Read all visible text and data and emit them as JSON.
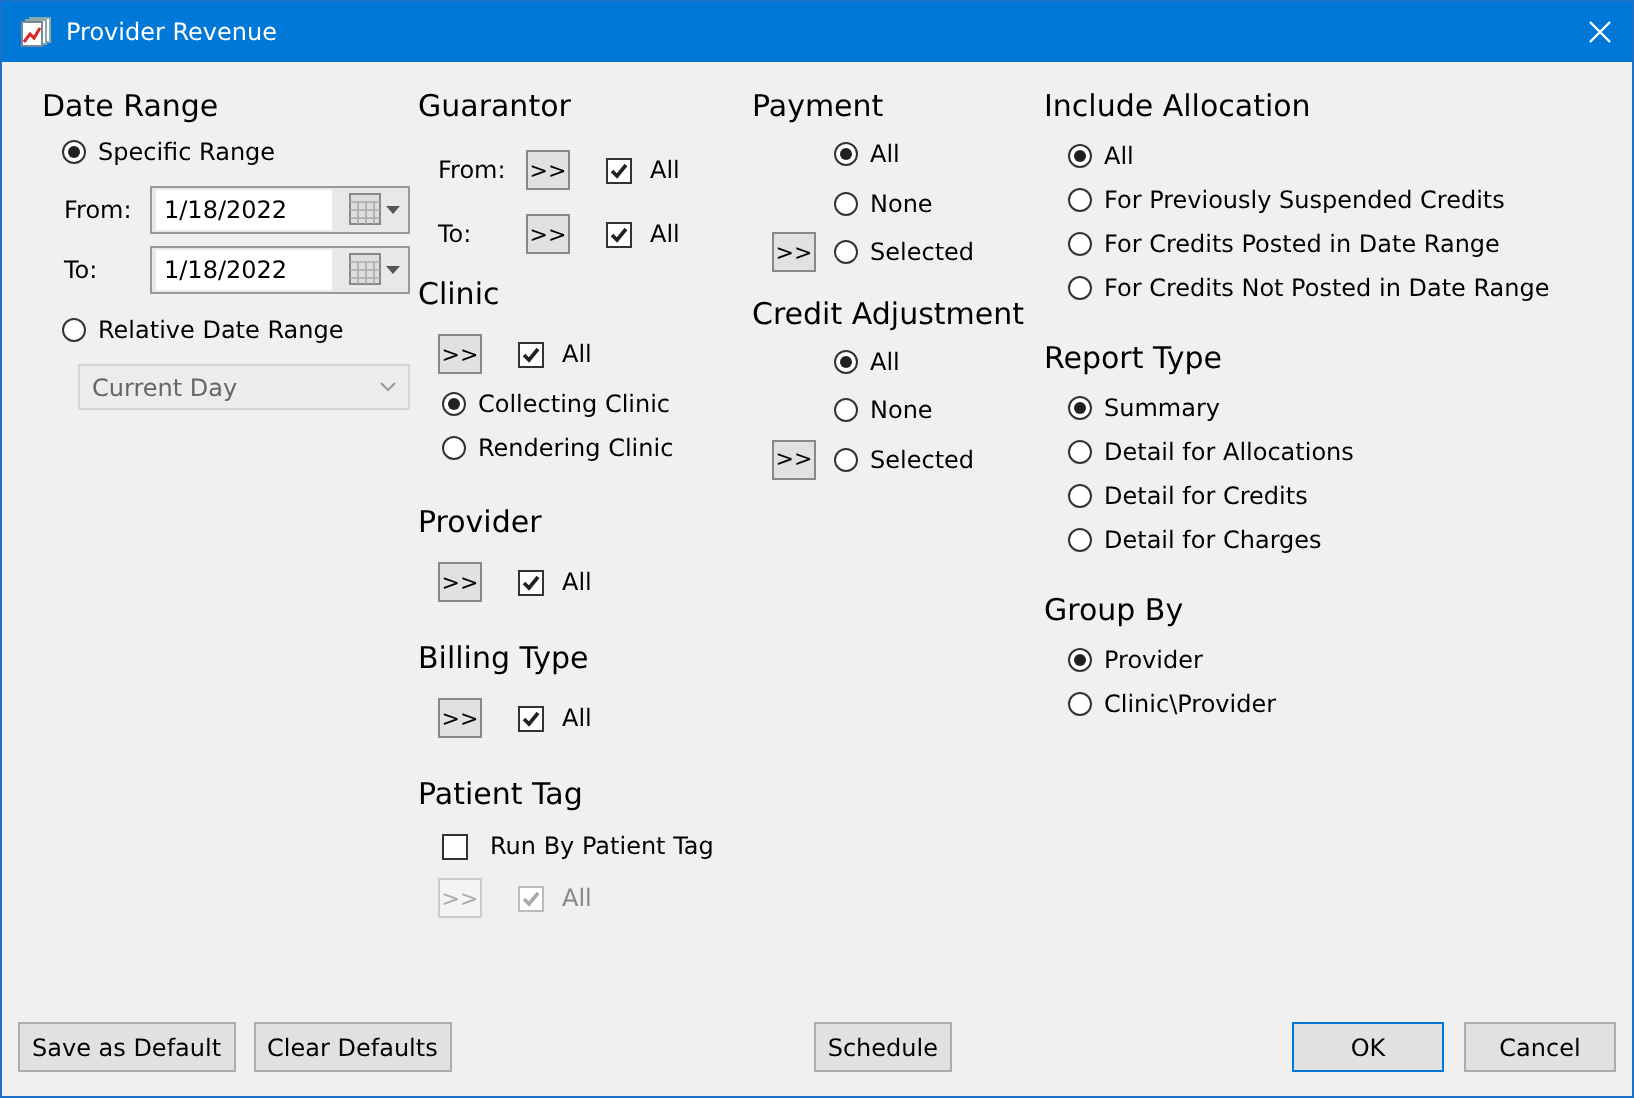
{
  "window": {
    "title": "Provider Revenue"
  },
  "date_range": {
    "title": "Date Range",
    "specific": {
      "label": "Specific Range",
      "selected": true
    },
    "from": {
      "label": "From:",
      "value": "1/18/2022"
    },
    "to": {
      "label": "To:",
      "value": "1/18/2022"
    },
    "relative": {
      "label": "Relative Date Range",
      "selected": false
    },
    "relative_select": {
      "value": "Current Day",
      "disabled": true
    }
  },
  "guarantor": {
    "title": "Guarantor",
    "rows": [
      {
        "label": "From:",
        "button": ">>",
        "all": {
          "label": "All",
          "checked": true
        }
      },
      {
        "label": "To:",
        "button": ">>",
        "all": {
          "label": "All",
          "checked": true
        }
      }
    ]
  },
  "clinic": {
    "title": "Clinic",
    "button": ">>",
    "all": {
      "label": "All",
      "checked": true
    },
    "options": [
      {
        "label": "Collecting Clinic",
        "selected": true
      },
      {
        "label": "Rendering Clinic",
        "selected": false
      }
    ]
  },
  "provider": {
    "title": "Provider",
    "button": ">>",
    "all": {
      "label": "All",
      "checked": true
    }
  },
  "billing_type": {
    "title": "Billing Type",
    "button": ">>",
    "all": {
      "label": "All",
      "checked": true
    }
  },
  "patient_tag": {
    "title": "Patient Tag",
    "run_by": {
      "label": "Run By Patient Tag",
      "checked": false
    },
    "button": ">>",
    "all": {
      "label": "All",
      "checked": true
    },
    "disabled": true
  },
  "payment": {
    "title": "Payment",
    "button": ">>",
    "options": [
      {
        "label": "All",
        "selected": true
      },
      {
        "label": "None",
        "selected": false
      },
      {
        "label": "Selected",
        "selected": false
      }
    ]
  },
  "credit_adjustment": {
    "title": "Credit Adjustment",
    "button": ">>",
    "options": [
      {
        "label": "All",
        "selected": true
      },
      {
        "label": "None",
        "selected": false
      },
      {
        "label": "Selected",
        "selected": false
      }
    ]
  },
  "include_allocation": {
    "title": "Include Allocation",
    "options": [
      {
        "label": "All",
        "selected": true
      },
      {
        "label": "For Previously Suspended Credits",
        "selected": false
      },
      {
        "label": "For Credits Posted in Date Range",
        "selected": false
      },
      {
        "label": "For Credits Not Posted in Date Range",
        "selected": false
      }
    ]
  },
  "report_type": {
    "title": "Report Type",
    "options": [
      {
        "label": "Summary",
        "selected": true
      },
      {
        "label": "Detail for Allocations",
        "selected": false
      },
      {
        "label": "Detail for Credits",
        "selected": false
      },
      {
        "label": "Detail for Charges",
        "selected": false
      }
    ]
  },
  "group_by": {
    "title": "Group By",
    "options": [
      {
        "label": "Provider",
        "selected": true
      },
      {
        "label": "Clinic\\Provider",
        "selected": false
      }
    ]
  },
  "buttons": [
    {
      "label": "Save as Default",
      "kind": "left",
      "default": false
    },
    {
      "label": "Clear Defaults",
      "kind": "left",
      "default": false
    },
    {
      "label": "Schedule",
      "kind": "center",
      "default": false
    },
    {
      "label": "OK",
      "kind": "right",
      "default": true
    },
    {
      "label": "Cancel",
      "kind": "right",
      "default": false
    }
  ]
}
